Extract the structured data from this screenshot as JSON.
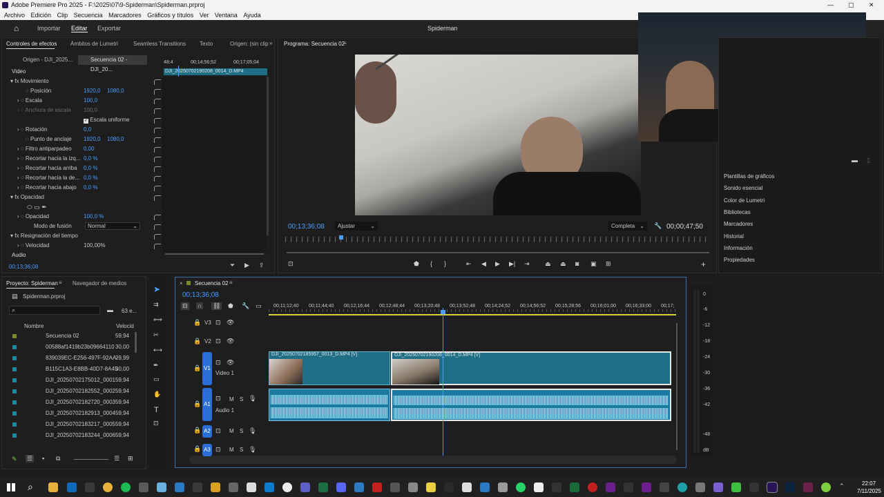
{
  "window": {
    "title": "Adobe Premiere Pro 2025 - F:\\2025\\07\\9-Spiderman\\Spiderman.prproj"
  },
  "menu": [
    "Archivo",
    "Edición",
    "Clip",
    "Secuencia",
    "Marcadores",
    "Gráficos y títulos",
    "Ver",
    "Ventana",
    "Ayuda"
  ],
  "workspace": {
    "items": [
      "Importar",
      "Editar",
      "Exportar"
    ],
    "project_name": "Spiderman"
  },
  "effect_controls": {
    "tabs": [
      "Controles de efectos",
      "Ámbitos de Lumetri",
      "Seamless Transitions",
      "Texto",
      "Origen: (sin clip"
    ],
    "origin_label": "Origen - DJI_2025...",
    "sequence_label": "Secuencia 02 - DJI_20...",
    "timecodes": [
      "48:4",
      "00;14;56;52",
      "00;17;05;04"
    ],
    "clip_label": "DJI_20250702190208_0014_D.MP4",
    "video_header": "Video",
    "params": [
      {
        "name": "Movimiento",
        "value": "",
        "v2": ""
      },
      {
        "name": "Posición",
        "value": "1920,0",
        "v2": "1080,0"
      },
      {
        "name": "Escala",
        "value": "100,0",
        "v2": ""
      },
      {
        "name": "Anchura de escala",
        "value": "100,0",
        "v2": ""
      },
      {
        "name": "Escala uniforme",
        "value": "",
        "v2": ""
      },
      {
        "name": "Rotación",
        "value": "0,0",
        "v2": ""
      },
      {
        "name": "Punto de anclaje",
        "value": "1920,0",
        "v2": "1080,0"
      },
      {
        "name": "Filtro antiparpadeo",
        "value": "0,00",
        "v2": ""
      },
      {
        "name": "Recortar hacia la izq...",
        "value": "0,0 %",
        "v2": ""
      },
      {
        "name": "Recortar hacia arriba",
        "value": "0,0 %",
        "v2": ""
      },
      {
        "name": "Recortar hacia la de...",
        "value": "0,0 %",
        "v2": ""
      },
      {
        "name": "Recortar hacia abajo",
        "value": "0,0 %",
        "v2": ""
      },
      {
        "name": "Opacidad",
        "value": "",
        "v2": ""
      },
      {
        "name": "Opacidad",
        "value": "100,0 %",
        "v2": ""
      },
      {
        "name": "Modo de fusión",
        "value": "Normal",
        "v2": ""
      },
      {
        "name": "Resignación del tiempo",
        "value": "",
        "v2": ""
      },
      {
        "name": "Velocidad",
        "value": "100,00%",
        "v2": ""
      }
    ],
    "audio_header": "Audio",
    "timecode": "00;13;36;08"
  },
  "program": {
    "title": "Programa: Secuencia 02",
    "timecode": "00;13;36;08",
    "fit": "Ajustar",
    "quality": "Completa",
    "duration": "00;00;47;50"
  },
  "right_panel": {
    "items": [
      "Plantillas de gráficos",
      "Sonido esencial",
      "Color de Lumetri",
      "Bibliotecas",
      "Marcadores",
      "Historial",
      "Información",
      "Propiedades"
    ]
  },
  "project": {
    "tabs": [
      "Proyecto: Spiderman",
      "Navegador de medios"
    ],
    "file": "Spiderman.prproj",
    "count": "63 e...",
    "columns": [
      "Nombre",
      "Velocid"
    ],
    "items": [
      {
        "name": "Secuencia 02",
        "fps": "59,94",
        "color": "#7a8c2a"
      },
      {
        "name": "00588af1419b23b09664110",
        "fps": "30,00",
        "color": "#1a8aa0"
      },
      {
        "name": "839039EC-E256-497F-92AA-",
        "fps": "29,99",
        "color": "#1a8aa0"
      },
      {
        "name": "B115C1A3-E8BB-40D7-8A45",
        "fps": "30,00",
        "color": "#1a8aa0"
      },
      {
        "name": "DJI_20250702175012_0001",
        "fps": "59,94",
        "color": "#1a8aa0"
      },
      {
        "name": "DJI_20250702182552_0002",
        "fps": "59,94",
        "color": "#1a8aa0"
      },
      {
        "name": "DJI_20250702182720_0003",
        "fps": "59,94",
        "color": "#1a8aa0"
      },
      {
        "name": "DJI_20250702182913_0004",
        "fps": "59,94",
        "color": "#1a8aa0"
      },
      {
        "name": "DJI_20250702183217_0005",
        "fps": "59,94",
        "color": "#1a8aa0"
      },
      {
        "name": "DJI_20250702183244_0006",
        "fps": "59,94",
        "color": "#1a8aa0"
      }
    ]
  },
  "timeline": {
    "title": "Secuencia 02",
    "timecode": "00;13;36;08",
    "ruler": [
      "00;11;12;40",
      "00;11;44;40",
      "00;12;16;44",
      "00;12;48;44",
      "00;13;20;48",
      "00;13;52;48",
      "00;14;24;52",
      "00;14;56;52",
      "00;15;28;56",
      "00;16;01;00",
      "00;16;33;00",
      "00;17;"
    ],
    "tracks": [
      {
        "id": "V3",
        "name": ""
      },
      {
        "id": "V2",
        "name": ""
      },
      {
        "id": "V1",
        "name": "Video 1"
      },
      {
        "id": "A1",
        "name": "Audio 1"
      },
      {
        "id": "A2",
        "name": ""
      },
      {
        "id": "A3",
        "name": ""
      }
    ],
    "clip1": "DJI_20250702185957_0013_D.MP4 [V]",
    "clip2": "DJI_20250702190208_0014_D.MP4 [V]",
    "meter": [
      "0",
      "-6",
      "-12",
      "-18",
      "-24",
      "-30",
      "-36",
      "-42",
      "-48",
      "dB"
    ]
  },
  "taskbar": {
    "time": "22:07",
    "date": "7/11/2025"
  }
}
